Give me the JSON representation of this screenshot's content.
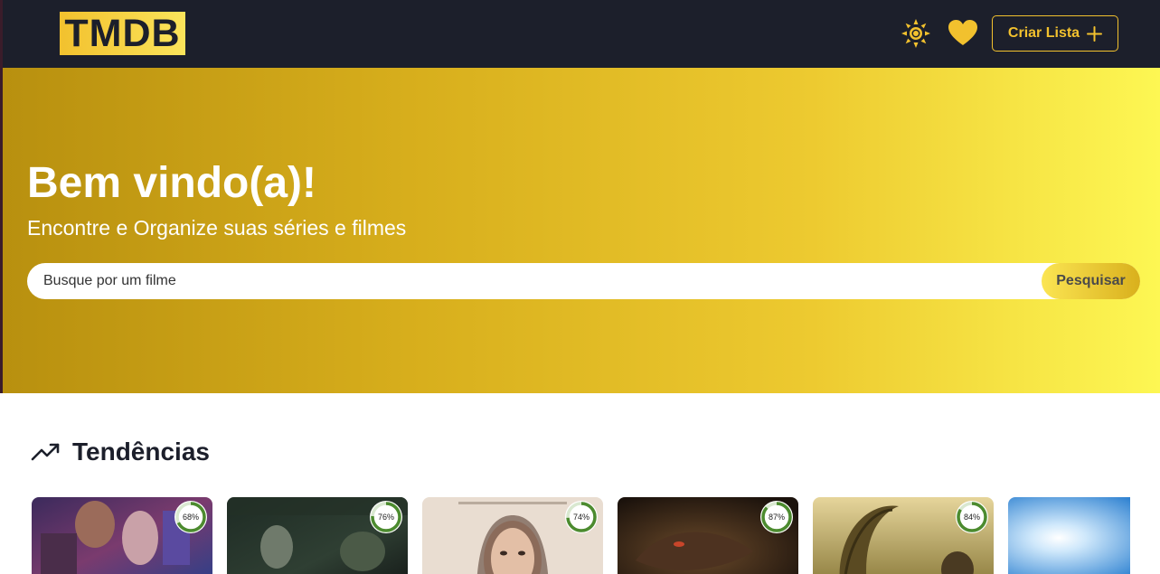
{
  "header": {
    "logo": "TMDB",
    "create_list_label": "Criar Lista",
    "icons": [
      "sun-icon",
      "heart-icon",
      "plus-icon"
    ],
    "accent_color": "#f2c12e"
  },
  "hero": {
    "title": "Bem vindo(a)!",
    "subtitle": "Encontre e Organize suas séries e filmes",
    "search_placeholder": "Busque por um filme",
    "search_button": "Pesquisar"
  },
  "trending": {
    "title": "Tendências",
    "icon": "trending-up-icon",
    "items": [
      {
        "score_label": "68%",
        "score": 0.68
      },
      {
        "score_label": "76%",
        "score": 0.76
      },
      {
        "score_label": "74%",
        "score": 0.74
      },
      {
        "score_label": "87%",
        "score": 0.87
      },
      {
        "score_label": "84%",
        "score": 0.84
      },
      {
        "score_label": "",
        "score": null
      }
    ]
  }
}
